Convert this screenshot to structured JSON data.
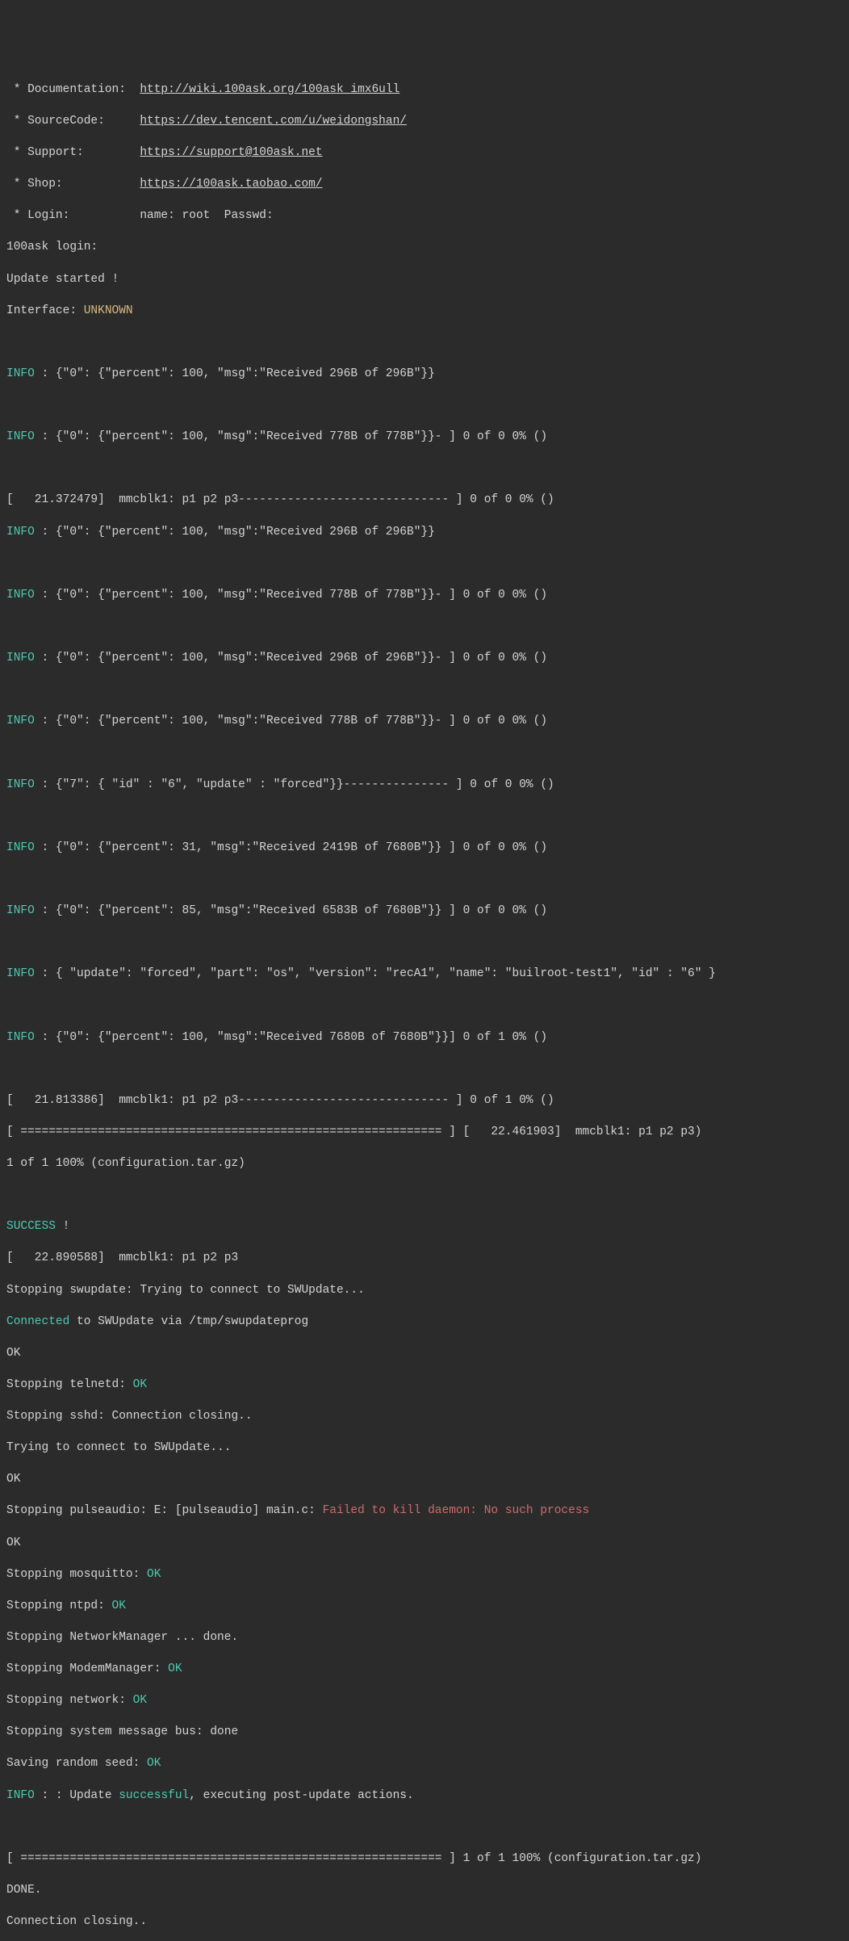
{
  "header": {
    "doc_label": " * Documentation:  ",
    "doc_link": "http://wiki.100ask.org/100ask_imx6ull",
    "src_label": " * SourceCode:     ",
    "src_link": "https://dev.tencent.com/u/weidongshan/",
    "sup_label": " * Support:        ",
    "sup_link": "https://support@100ask.net",
    "shop_label": " * Shop:           ",
    "shop_link": "https://100ask.taobao.com/",
    "login_label": " * Login:          name: root  Passwd: ",
    "login_prompt": "100ask login: ",
    "update_started": "Update started !",
    "interface_label": "Interface: ",
    "interface_value": "UNKNOWN"
  },
  "log": {
    "l1a": "INFO",
    "l1b": " : {\"0\": {\"percent\": 100, \"msg\":\"Received 296B of 296B\"}}",
    "l2a": "INFO",
    "l2b": " : {\"0\": {\"percent\": 100, \"msg\":\"Received 778B of 778B\"}}- ] 0 of 0 0% ()",
    "l3": "[   21.372479]  mmcblk1: p1 p2 p3------------------------------ ] 0 of 0 0% ()",
    "l4a": "INFO",
    "l4b": " : {\"0\": {\"percent\": 100, \"msg\":\"Received 296B of 296B\"}}",
    "l5a": "INFO",
    "l5b": " : {\"0\": {\"percent\": 100, \"msg\":\"Received 778B of 778B\"}}- ] 0 of 0 0% ()",
    "l6a": "INFO",
    "l6b": " : {\"0\": {\"percent\": 100, \"msg\":\"Received 296B of 296B\"}}- ] 0 of 0 0% ()",
    "l7a": "INFO",
    "l7b": " : {\"0\": {\"percent\": 100, \"msg\":\"Received 778B of 778B\"}}- ] 0 of 0 0% ()",
    "l8a": "INFO",
    "l8b": " : {\"7\": { \"id\" : \"6\", \"update\" : \"forced\"}}--------------- ] 0 of 0 0% ()",
    "l9a": "INFO",
    "l9b": " : {\"0\": {\"percent\": 31, \"msg\":\"Received 2419B of 7680B\"}} ] 0 of 0 0% ()",
    "l10a": "INFO",
    "l10b": " : {\"0\": {\"percent\": 85, \"msg\":\"Received 6583B of 7680B\"}} ] 0 of 0 0% ()",
    "l11a": "INFO",
    "l11b": " : { \"update\": \"forced\", \"part\": \"os\", \"version\": \"recA1\", \"name\": \"builroot-test1\", \"id\" : \"6\" }",
    "l12a": "INFO",
    "l12b": " : {\"0\": {\"percent\": 100, \"msg\":\"Received 7680B of 7680B\"}}] 0 of 1 0% ()",
    "l13": "[   21.813386]  mmcblk1: p1 p2 p3------------------------------ ] 0 of 1 0% ()",
    "l14": "[ ============================================================ ] [   22.461903]  mmcblk1: p1 p2 p3)",
    "l15": "1 of 1 100% (configuration.tar.gz)",
    "l16a": "SUCCESS",
    "l16b": " !",
    "l17": "[   22.890588]  mmcblk1: p1 p2 p3",
    "l18": "Stopping swupdate: Trying to connect to SWUpdate...",
    "l19a": "Connected",
    "l19b": " to SWUpdate via /tmp/swupdateprog",
    "l20": "OK",
    "l21a": "Stopping telnetd: ",
    "l21b": "OK",
    "l22": "Stopping sshd: Connection closing..",
    "l23": "Trying to connect to SWUpdate...",
    "l24": "OK",
    "l25a": "Stopping pulseaudio: E: [pulseaudio] main.c: ",
    "l25b": "Failed to kill daemon: No such process",
    "l26": "OK",
    "l27a": "Stopping mosquitto: ",
    "l27b": "OK",
    "l28a": "Stopping ntpd: ",
    "l28b": "OK",
    "l29": "Stopping NetworkManager ... done.",
    "l30a": "Stopping ModemManager: ",
    "l30b": "OK",
    "l31a": "Stopping network: ",
    "l31b": "OK",
    "l32": "Stopping system message bus: done",
    "l33a": "Saving random seed: ",
    "l33b": "OK",
    "l34a": "INFO",
    "l34b": " : : Update ",
    "l34c": "successful",
    "l34d": ", executing post-update actions.",
    "l35": "[ ============================================================ ] 1 of 1 100% (configuration.tar.gz)",
    "l36": "DONE.",
    "l37": "Connection closing.."
  }
}
